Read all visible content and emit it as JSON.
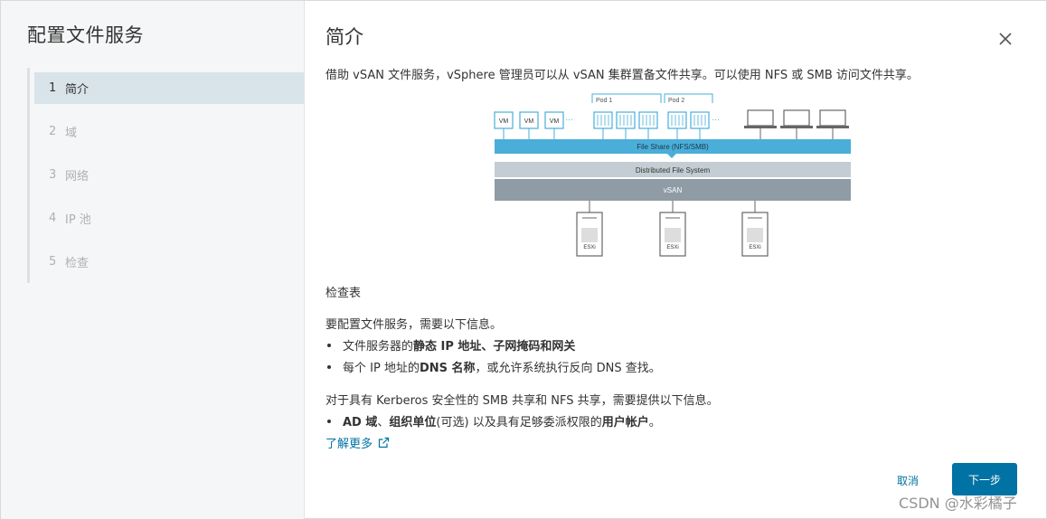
{
  "wizard": {
    "title": "配置文件服务",
    "steps": [
      {
        "num": "1",
        "label": "简介"
      },
      {
        "num": "2",
        "label": "域"
      },
      {
        "num": "3",
        "label": "网络"
      },
      {
        "num": "4",
        "label": "IP 池"
      },
      {
        "num": "5",
        "label": "检查"
      }
    ],
    "active_step": 0
  },
  "page": {
    "title": "简介",
    "intro": "借助 vSAN 文件服务，vSphere 管理员可以从 vSAN 集群置备文件共享。可以使用 NFS 或 SMB 访问文件共享。"
  },
  "diagram": {
    "pod1": "Pod 1",
    "pod2": "Pod 2",
    "vm": "VM",
    "file_share": "File Share (NFS/SMB)",
    "dfs": "Distributed File System",
    "vsan": "vSAN",
    "esxi": "ESXi",
    "colors": {
      "share_bar": "#4aaed9",
      "dfs_bar": "#c3cdd3",
      "vsan_bar": "#8f9ca6"
    }
  },
  "checklist": {
    "heading": "检查表",
    "para1": "要配置文件服务，需要以下信息。",
    "bullet1_pre": "文件服务器的",
    "bullet1_bold": "静态 IP 地址、子网掩码和网关",
    "bullet2_pre": "每个 IP 地址的 ",
    "bullet2_bold": "DNS 名称",
    "bullet2_post": "，或允许系统执行反向 DNS 查找。",
    "para2": "对于具有 Kerberos 安全性的 SMB 共享和 NFS 共享，需要提供以下信息。",
    "bullet3_bold1": "AD 域",
    "bullet3_sep": "、",
    "bullet3_bold2": "组织单位",
    "bullet3_mid": " (可选) 以及具有足够委派权限的",
    "bullet3_bold3": "用户帐户",
    "bullet3_end": "。",
    "learn_more": "了解更多"
  },
  "footer": {
    "cancel": "取消",
    "next": "下一步"
  },
  "watermark": "CSDN @水彩橘子",
  "accent_color": "#0072a3"
}
